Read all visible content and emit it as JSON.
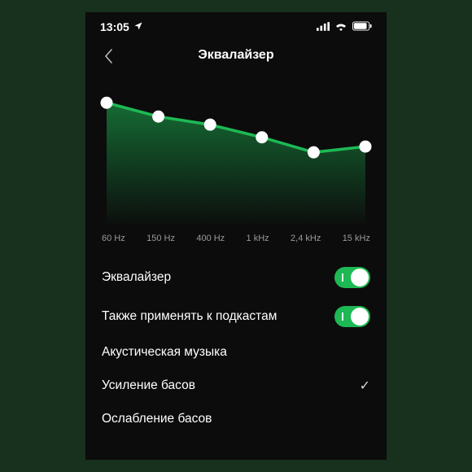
{
  "status": {
    "time": "13:05",
    "location_icon": "location-arrow",
    "signal_icon": "signal",
    "wifi_icon": "wifi",
    "battery_icon": "battery"
  },
  "nav": {
    "back_icon": "chevron-left",
    "title": "Эквалайзер"
  },
  "chart_data": {
    "type": "line",
    "categories": [
      "60 Hz",
      "150 Hz",
      "400 Hz",
      "1 kHz",
      "2,4 kHz",
      "15 kHz"
    ],
    "values": [
      4.5,
      3.3,
      2.6,
      1.5,
      0.2,
      0.7
    ],
    "ylim": [
      -6,
      6
    ],
    "fill_color": "#1db954",
    "handle_color": "#ffffff"
  },
  "settings": {
    "equalizer": {
      "label": "Эквалайзер",
      "on": true
    },
    "apply_podcasts": {
      "label": "Также применять к подкастам",
      "on": true
    },
    "presets": [
      {
        "label": "Акустическая музыка",
        "selected": false
      },
      {
        "label": "Усиление басов",
        "selected": true
      },
      {
        "label": "Ослабление басов",
        "selected": false
      }
    ]
  }
}
